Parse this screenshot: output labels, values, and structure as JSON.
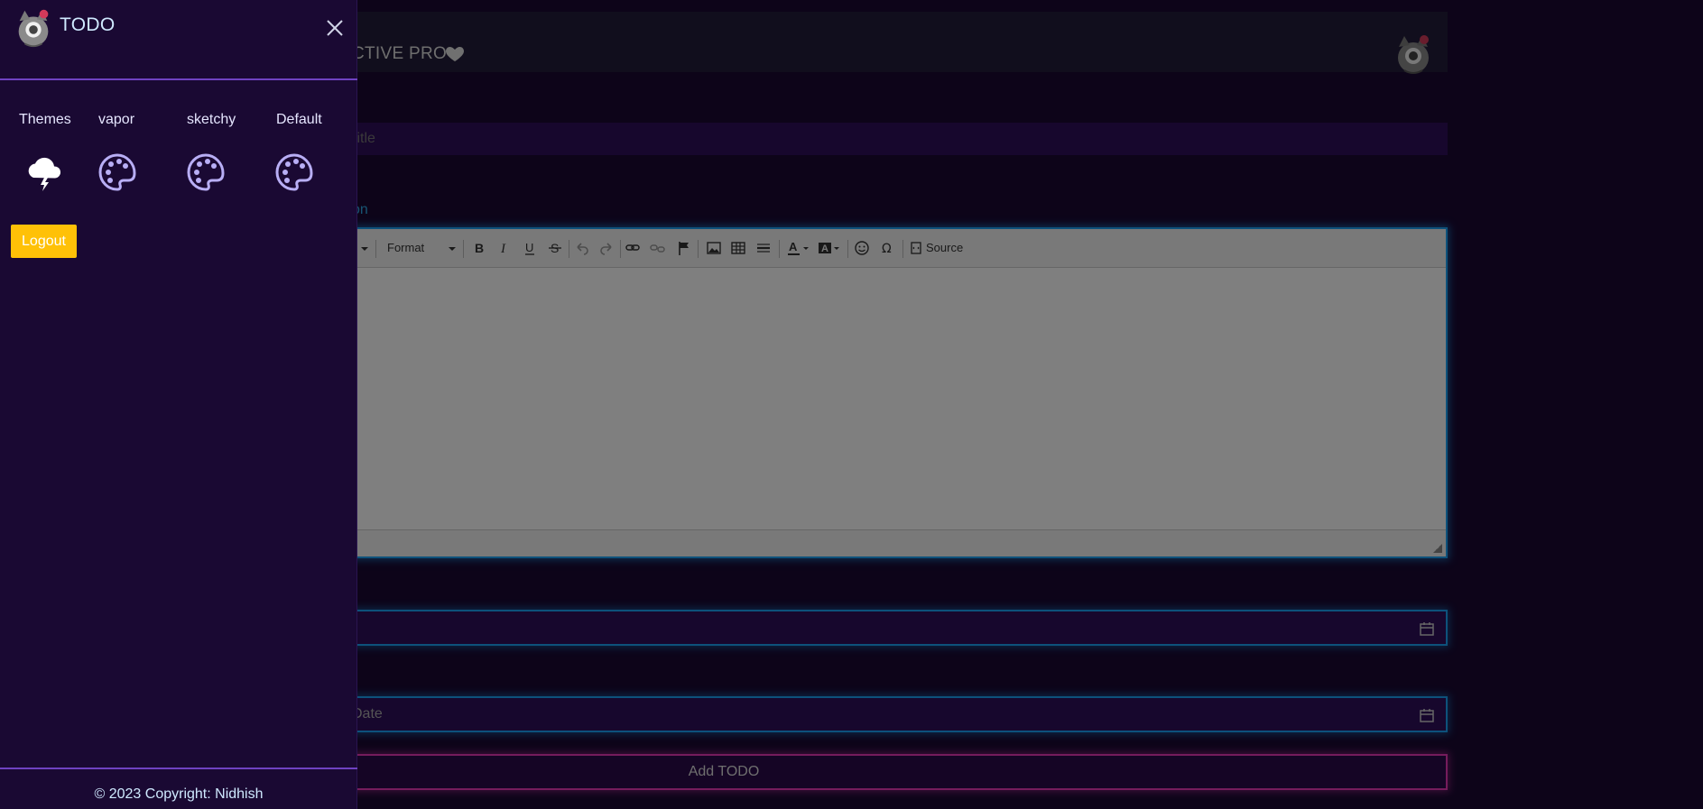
{
  "sidebar": {
    "title": "TODO",
    "close_icon": "close-icon",
    "themes": [
      {
        "label": "Themes",
        "icon": "cloud-lightning-icon"
      },
      {
        "label": "vapor",
        "icon": "palette-icon"
      },
      {
        "label": "sketchy",
        "icon": "palette-icon"
      },
      {
        "label": "Default",
        "icon": "palette-icon"
      }
    ],
    "logout_label": "Logout",
    "copyright": "© 2023 Copyright: Nidhish"
  },
  "navbar": {
    "brand": "CTIVE PRO"
  },
  "form": {
    "title_placeholder": "title",
    "description_label": "tion",
    "editor_toolbar": {
      "format_label": "Format",
      "source_label": "Source"
    },
    "end_date_placeholder": "Date",
    "submit_label": "Add TODO"
  },
  "colors": {
    "background": "#1a0933",
    "accent_purple": "#6f42c1",
    "logout_yellow": "#ffc107",
    "input_border_blue": "#1ba2f6",
    "button_border_pink": "#ea39b8"
  }
}
